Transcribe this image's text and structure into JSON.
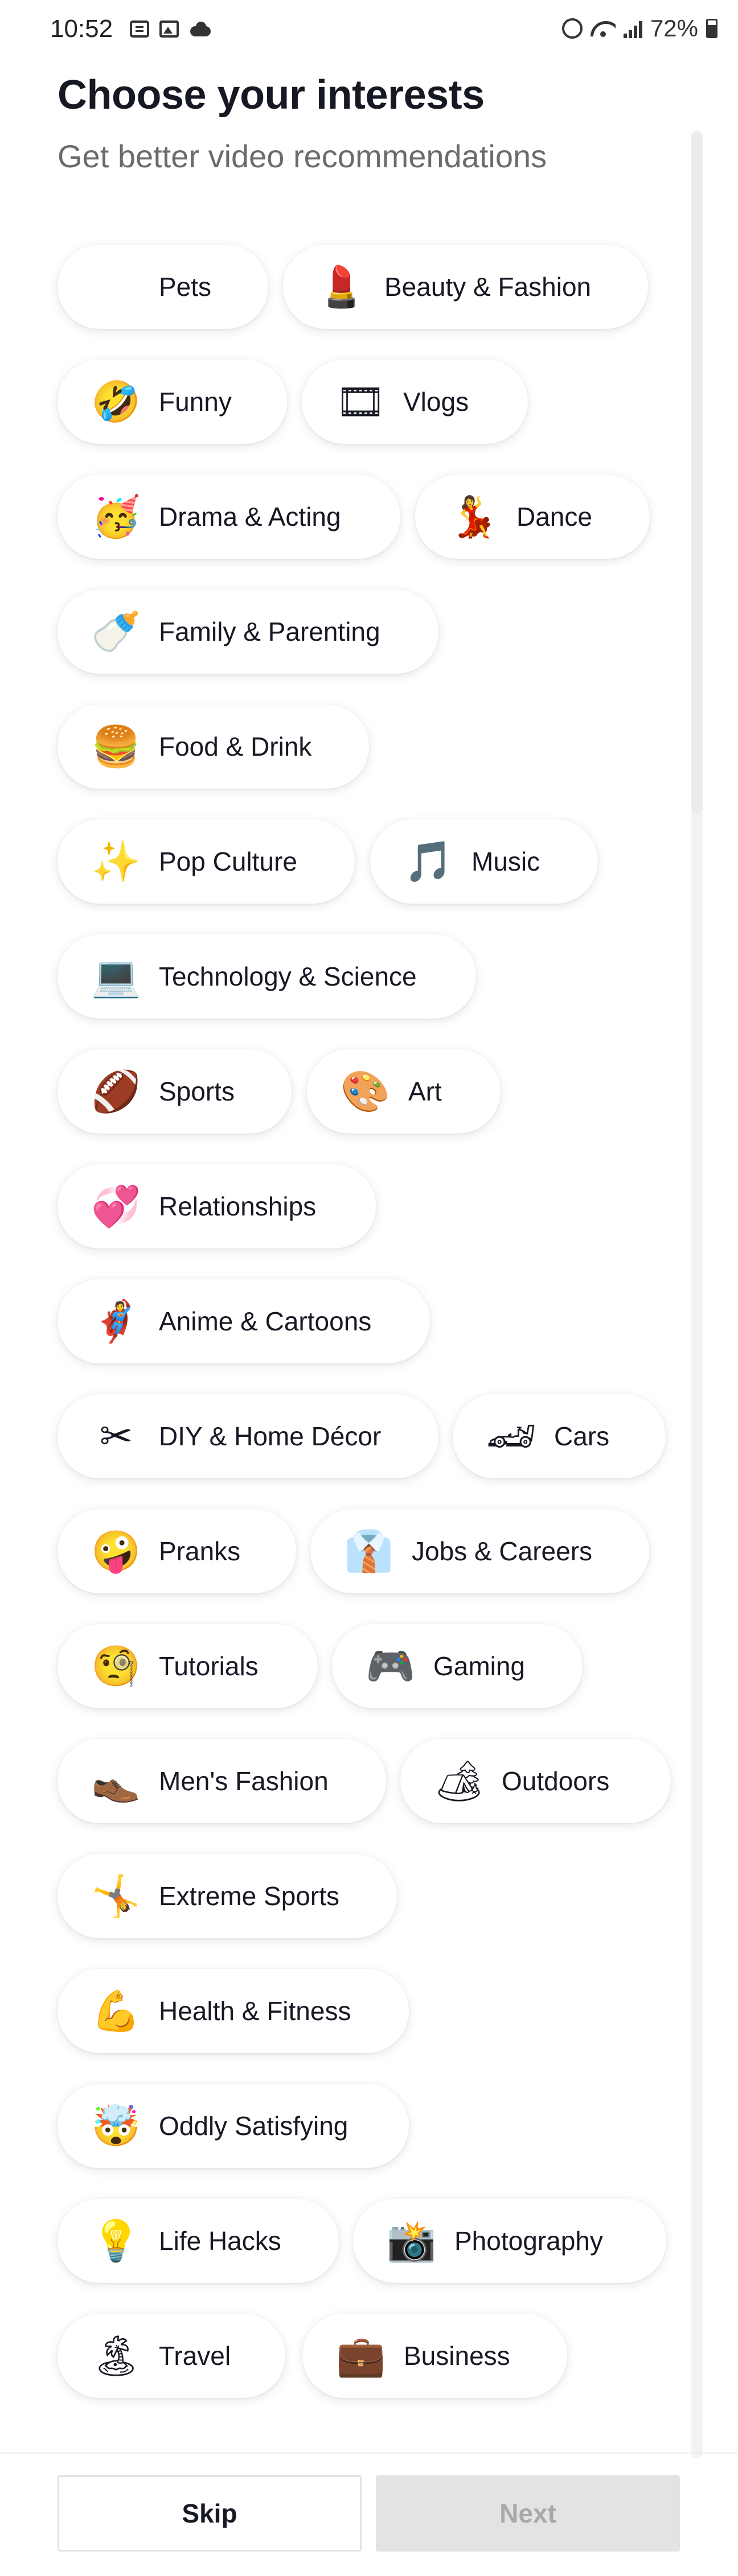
{
  "status_bar": {
    "time": "10:52",
    "battery": "72%"
  },
  "header": {
    "title": "Choose your interests",
    "subtitle": "Get better video recommendations"
  },
  "interests": [
    {
      "label": "Pets",
      "icon": "",
      "icon_name": "pets-icon"
    },
    {
      "label": "Beauty & Fashion",
      "icon": "💄",
      "icon_name": "lipstick-icon"
    },
    {
      "label": "Funny",
      "icon": "🤣",
      "icon_name": "laughing-face-icon"
    },
    {
      "label": "Vlogs",
      "icon": "🎞",
      "icon_name": "film-frames-icon"
    },
    {
      "label": "Drama & Acting",
      "icon": "🥳",
      "icon_name": "party-face-icon"
    },
    {
      "label": "Dance",
      "icon": "💃",
      "icon_name": "dancer-icon"
    },
    {
      "label": "Family & Parenting",
      "icon": "🍼",
      "icon_name": "baby-bottle-icon"
    },
    {
      "label": "Food & Drink",
      "icon": "🍔",
      "icon_name": "hamburger-icon"
    },
    {
      "label": "Pop Culture",
      "icon": "✨",
      "icon_name": "sparkles-icon"
    },
    {
      "label": "Music",
      "icon": "🎵",
      "icon_name": "music-note-icon"
    },
    {
      "label": "Technology & Science",
      "icon": "💻",
      "icon_name": "laptop-icon"
    },
    {
      "label": "Sports",
      "icon": "🏈",
      "icon_name": "football-icon"
    },
    {
      "label": "Art",
      "icon": "🎨",
      "icon_name": "palette-icon"
    },
    {
      "label": "Relationships",
      "icon": "💞",
      "icon_name": "revolving-hearts-icon"
    },
    {
      "label": "Anime & Cartoons",
      "icon": "🦸",
      "icon_name": "superhero-icon"
    },
    {
      "label": "DIY & Home Décor",
      "icon": "✂",
      "icon_name": "scissors-icon"
    },
    {
      "label": "Cars",
      "icon": "🏎",
      "icon_name": "race-car-icon"
    },
    {
      "label": "Pranks",
      "icon": "🤪",
      "icon_name": "zany-face-icon"
    },
    {
      "label": "Jobs & Careers",
      "icon": "👔",
      "icon_name": "necktie-icon"
    },
    {
      "label": "Tutorials",
      "icon": "🧐",
      "icon_name": "monocle-face-icon"
    },
    {
      "label": "Gaming",
      "icon": "🎮",
      "icon_name": "game-controller-icon"
    },
    {
      "label": "Men's Fashion",
      "icon": "👞",
      "icon_name": "mans-shoe-icon"
    },
    {
      "label": "Outdoors",
      "icon": "🏕",
      "icon_name": "camping-icon"
    },
    {
      "label": "Extreme Sports",
      "icon": "🤸",
      "icon_name": "cartwheel-icon"
    },
    {
      "label": "Health & Fitness",
      "icon": "💪",
      "icon_name": "flexed-biceps-icon"
    },
    {
      "label": "Oddly Satisfying",
      "icon": "🤯",
      "icon_name": "exploding-head-icon"
    },
    {
      "label": "Life Hacks",
      "icon": "💡",
      "icon_name": "light-bulb-icon"
    },
    {
      "label": "Photography",
      "icon": "📸",
      "icon_name": "camera-flash-icon"
    },
    {
      "label": "Travel",
      "icon": "🏝",
      "icon_name": "beach-umbrella-icon"
    },
    {
      "label": "Business",
      "icon": "💼",
      "icon_name": "briefcase-icon"
    }
  ],
  "footer": {
    "skip_label": "Skip",
    "next_label": "Next"
  },
  "colors": {
    "text": "#161823",
    "subtitle": "#6a6a6f",
    "next_disabled_bg": "#e3e3e4",
    "next_disabled_text": "#a8a8ab"
  }
}
